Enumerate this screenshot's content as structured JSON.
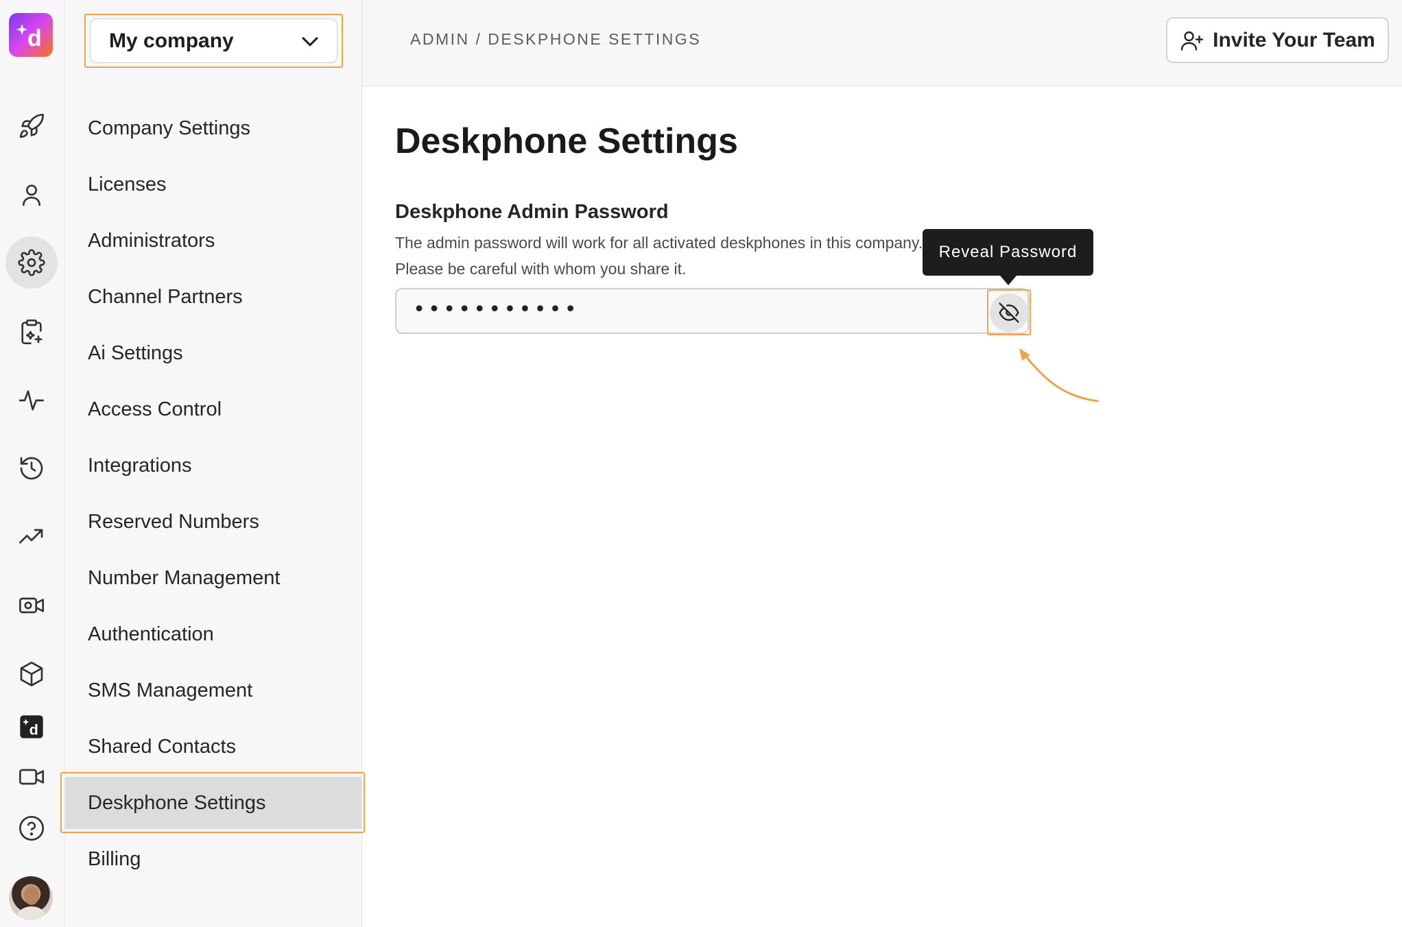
{
  "company_select": {
    "value": "My company"
  },
  "breadcrumb": "ADMIN / DESKPHONE SETTINGS",
  "header": {
    "invite_label": "Invite Your Team"
  },
  "rail": {
    "icons": [
      "rocket-icon",
      "user-icon",
      "gear-icon",
      "clipboard-sparkle-icon",
      "activity-icon",
      "history-icon",
      "trending-up-icon",
      "video-gear-icon",
      "cube-icon",
      "dialpad-icon",
      "video-icon",
      "help-icon"
    ],
    "active": "gear-icon"
  },
  "menu": {
    "items": [
      "Company Settings",
      "Licenses",
      "Administrators",
      "Channel Partners",
      "Ai Settings",
      "Access Control",
      "Integrations",
      "Reserved Numbers",
      "Number Management",
      "Authentication",
      "SMS Management",
      "Shared Contacts",
      "Deskphone Settings",
      "Billing"
    ],
    "active": "Deskphone Settings"
  },
  "main": {
    "title": "Deskphone Settings",
    "section_title": "Deskphone Admin Password",
    "desc_line1": "The admin password will work for all activated deskphones in this company.",
    "desc_line2": "Please be careful with whom you share it.",
    "password_masked": "•••••••••••",
    "tooltip": "Reveal Password"
  },
  "colors": {
    "highlight": "#f0a24a",
    "tooltip_bg": "#1d1d1d",
    "active_bg": "#dcdcdc"
  }
}
